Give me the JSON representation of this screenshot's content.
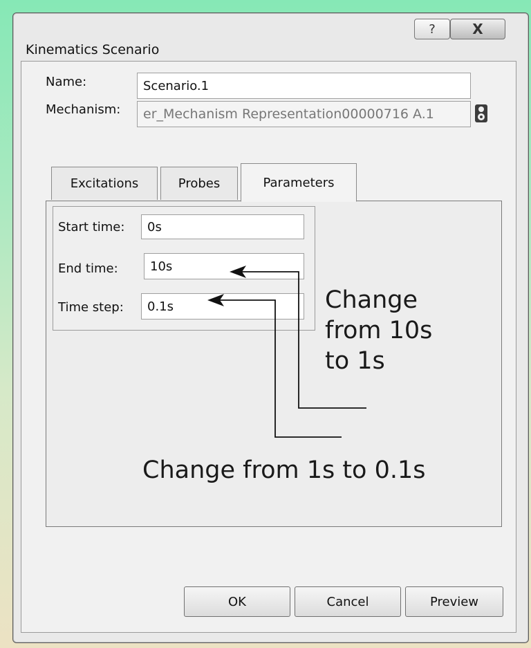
{
  "window": {
    "title": "Kinematics Scenario",
    "help_label": "?",
    "close_label": "X"
  },
  "form": {
    "name_label": "Name:",
    "name_value": "Scenario.1",
    "mechanism_label": "Mechanism:",
    "mechanism_value": "er_Mechanism Representation00000716 A.1",
    "mechanism_icon": "mechanism-icon"
  },
  "tabs": [
    {
      "label": "Excitations",
      "active": false
    },
    {
      "label": "Probes",
      "active": false
    },
    {
      "label": "Parameters",
      "active": true
    }
  ],
  "parameters": {
    "start_time_label": "Start time:",
    "start_time_value": "0s",
    "end_time_label": "End time:",
    "end_time_value": "10s",
    "time_step_label": "Time step:",
    "time_step_value": "0.1s"
  },
  "annotations": {
    "end_time_note_lines": [
      "Change",
      "from 10s",
      "to 1s"
    ],
    "time_step_note": "Change from 1s to 0.1s"
  },
  "buttons": {
    "ok": "OK",
    "cancel": "Cancel",
    "preview": "Preview"
  },
  "colors": {
    "background_top": "#86e8b6",
    "background_bottom": "#ece2c3",
    "dialog": "#e9e9e9"
  }
}
